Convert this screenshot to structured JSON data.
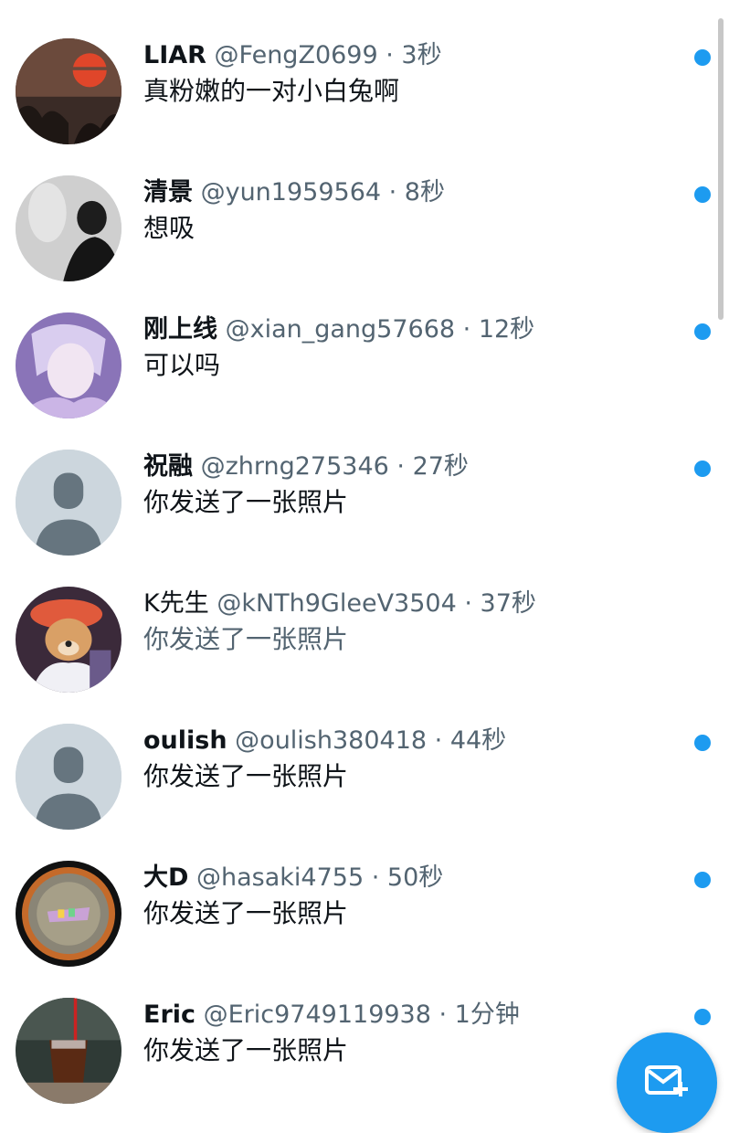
{
  "conversations": [
    {
      "name": "LIAR",
      "handle": "@FengZ0699",
      "time": "3秒",
      "message": "真粉嫩的一对小白兔啊",
      "unread": true,
      "avatar": "sunset-avatar"
    },
    {
      "name": "清景",
      "handle": "@yun1959564",
      "time": "8秒",
      "message": "想吸",
      "unread": true,
      "avatar": "person-photo-avatar"
    },
    {
      "name": "刚上线",
      "handle": "@xian_gang57668",
      "time": "12秒",
      "message": "可以吗",
      "unread": true,
      "avatar": "anime-avatar"
    },
    {
      "name": "祝融",
      "handle": "@zhrng275346",
      "time": "27秒",
      "message": "你发送了一张照片",
      "unread": true,
      "avatar": "default-avatar"
    },
    {
      "name": "K先生",
      "handle": "@kNTh9GleeV3504",
      "time": "37秒",
      "message": "你发送了一张照片",
      "unread": false,
      "avatar": "dog-avatar"
    },
    {
      "name": "oulish",
      "handle": "@oulish380418",
      "time": "44秒",
      "message": "你发送了一张照片",
      "unread": true,
      "avatar": "default-avatar"
    },
    {
      "name": "大D",
      "handle": "@hasaki4755",
      "time": "50秒",
      "message": "你发送了一张照片",
      "unread": true,
      "avatar": "coin-avatar"
    },
    {
      "name": "Eric",
      "handle": "@Eric9749119938",
      "time": "1分钟",
      "message": "你发送了一张照片",
      "unread": true,
      "avatar": "drink-avatar"
    }
  ],
  "separator": " · ",
  "fab": {
    "icon": "new-message-icon"
  },
  "colors": {
    "accent": "#1d9bf0",
    "primary_text": "#0f1419",
    "secondary_text": "#536471",
    "default_avatar_bg": "#ccd6dd",
    "default_avatar_fg": "#66757f"
  }
}
